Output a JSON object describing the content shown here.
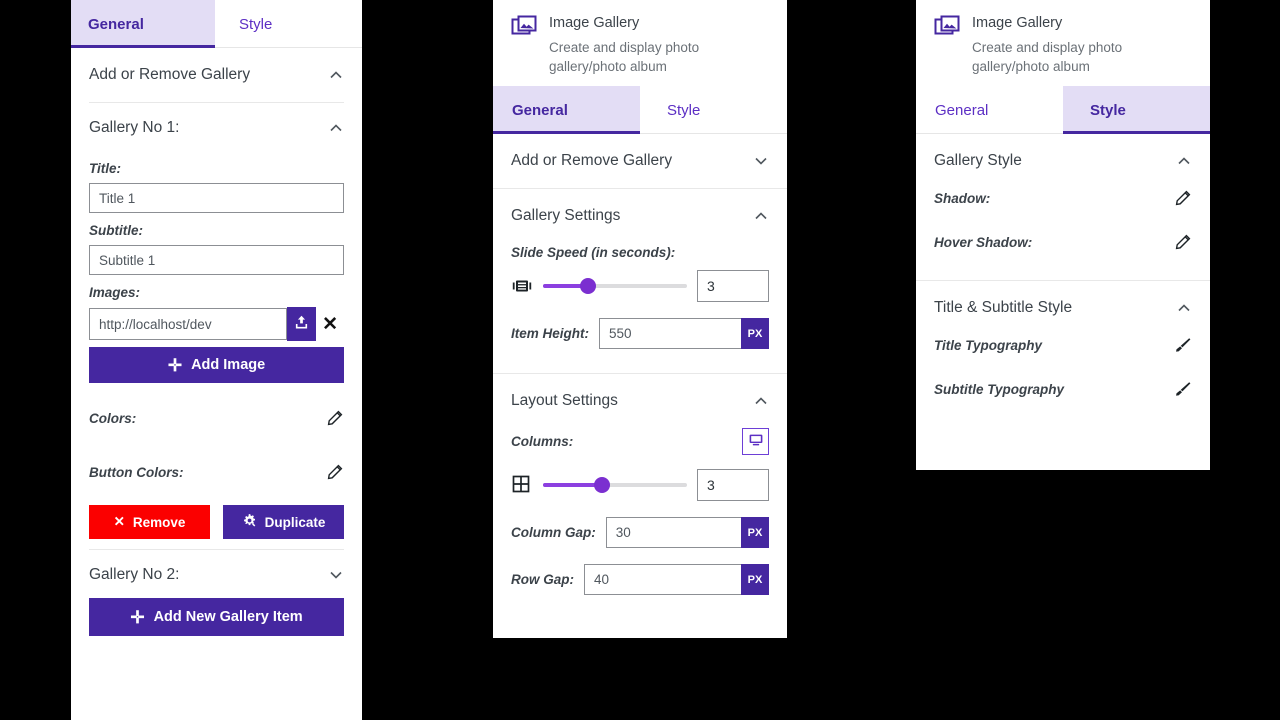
{
  "widget": {
    "icon": "image-gallery-icon",
    "title": "Image Gallery",
    "description": "Create and display photo gallery/photo album"
  },
  "tabs": {
    "general": "General",
    "style": "Style"
  },
  "panel_left": {
    "active_tab": "General",
    "sections": {
      "add_or_remove_gallery": "Add or Remove Gallery"
    },
    "gallery_1": {
      "heading": "Gallery No 1:",
      "title_label": "Title:",
      "title_value": "Title 1",
      "subtitle_label": "Subtitle:",
      "subtitle_value": "Subtitle 1",
      "images_label": "Images:",
      "image_url": "http://localhost/dev",
      "upload_icon": "upload-icon",
      "remove_image_icon": "close-icon",
      "add_image_button": "Add Image",
      "colors_label": "Colors:",
      "button_colors_label": "Button Colors:",
      "remove_button": "Remove",
      "duplicate_button": "Duplicate"
    },
    "gallery_2": {
      "heading": "Gallery No 2:"
    },
    "add_new_gallery_item": "Add New Gallery Item"
  },
  "panel_middle": {
    "active_tab": "General",
    "sections": {
      "add_or_remove_gallery": "Add or Remove Gallery",
      "gallery_settings": "Gallery Settings",
      "layout_settings": "Layout Settings"
    },
    "gallery_settings": {
      "slide_speed_label": "Slide Speed (in seconds):",
      "slide_speed_value": "3",
      "slide_speed_percent": 31,
      "slide_speed_icon": "slideshow-icon",
      "item_height_label": "Item Height:",
      "item_height_value": "550",
      "item_height_unit": "PX"
    },
    "layout_settings": {
      "columns_label": "Columns:",
      "columns_value": "3",
      "columns_percent": 41,
      "columns_icon": "grid-icon",
      "device_icon": "desktop-icon",
      "column_gap_label": "Column Gap:",
      "column_gap_value": "30",
      "column_gap_unit": "PX",
      "row_gap_label": "Row Gap:",
      "row_gap_value": "40",
      "row_gap_unit": "PX"
    }
  },
  "panel_right": {
    "active_tab": "Style",
    "sections": {
      "gallery_style": "Gallery Style",
      "title_subtitle_style": "Title & Subtitle Style"
    },
    "gallery_style": {
      "shadow_label": "Shadow:",
      "shadow_icon": "pencil-icon",
      "hover_shadow_label": "Hover Shadow:",
      "hover_shadow_icon": "pencil-icon"
    },
    "title_subtitle_style": {
      "title_typography_label": "Title Typography",
      "title_typography_icon": "brush-icon",
      "subtitle_typography_label": "Subtitle Typography",
      "subtitle_typography_icon": "brush-icon"
    }
  },
  "colors": {
    "accent_purple": "#4527a0",
    "tab_active_bg": "#e3ddf5",
    "slider_fill": "#8c3fe0",
    "danger_red": "#fb0000",
    "page_background": "#000000"
  }
}
